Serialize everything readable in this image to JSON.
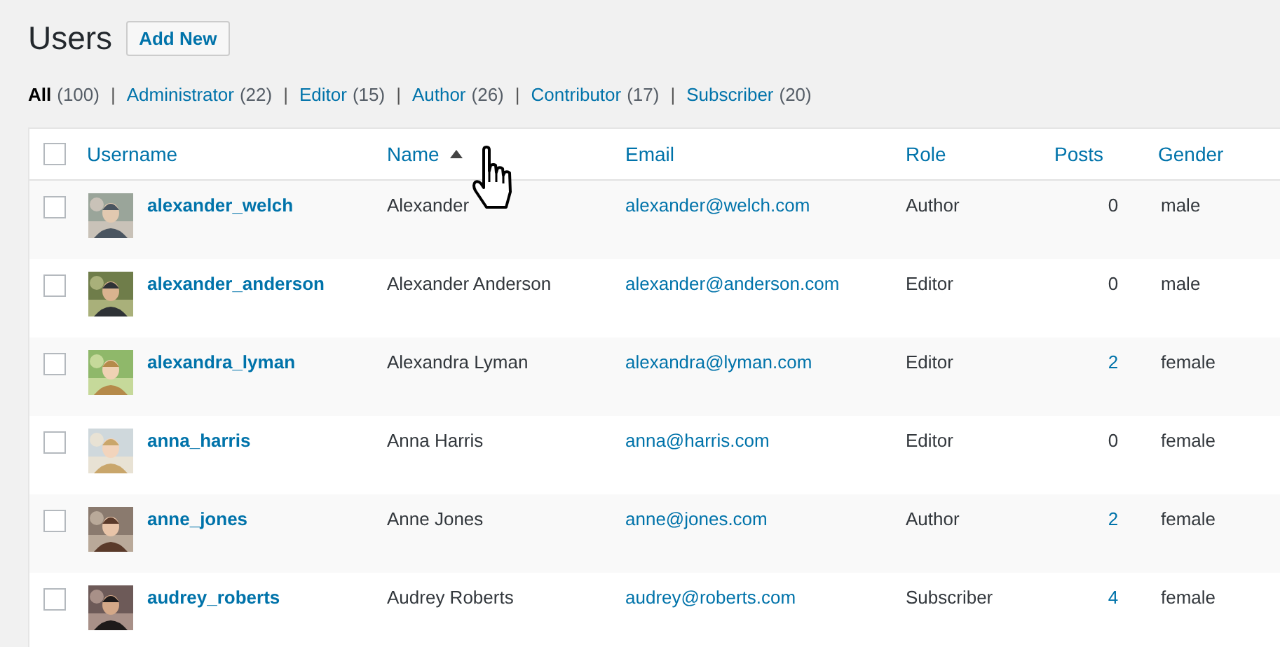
{
  "page_title": "Users",
  "add_button": "Add New",
  "filters": [
    {
      "label": "All",
      "count": "(100)",
      "selected": true
    },
    {
      "separator": "|",
      "label": "Administrator",
      "count": "(22)",
      "selected": false
    },
    {
      "separator": "|",
      "label": "Editor",
      "count": "(15)",
      "selected": false
    },
    {
      "separator": "|",
      "label": "Author",
      "count": "(26)",
      "selected": false
    },
    {
      "separator": "|",
      "label": "Contributor",
      "count": "(17)",
      "selected": false
    },
    {
      "separator": "|",
      "label": "Subscriber",
      "count": "(20)",
      "selected": false
    }
  ],
  "table": {
    "select_all_checked": false,
    "columns": [
      {
        "label": "Username",
        "sorted": false
      },
      {
        "label": "Name",
        "sorted": true
      },
      {
        "label": "Email",
        "sorted": false
      },
      {
        "label": "Role",
        "sorted": false
      },
      {
        "label": "Posts",
        "sorted": false
      },
      {
        "label": "Gender",
        "sorted": false
      }
    ],
    "rows": [
      {
        "checked": false,
        "username": "alexander_welch",
        "name": "Alexander",
        "email": "alexander@welch.com",
        "role": "Author",
        "posts": "0",
        "posts_linked": false,
        "gender": "male"
      },
      {
        "checked": false,
        "username": "alexander_anderson",
        "name": "Alexander Anderson",
        "email": "alexander@anderson.com",
        "role": "Editor",
        "posts": "0",
        "posts_linked": false,
        "gender": "male"
      },
      {
        "checked": false,
        "username": "alexandra_lyman",
        "name": "Alexandra Lyman",
        "email": "alexandra@lyman.com",
        "role": "Editor",
        "posts": "2",
        "posts_linked": true,
        "gender": "female"
      },
      {
        "checked": false,
        "username": "anna_harris",
        "name": "Anna Harris",
        "email": "anna@harris.com",
        "role": "Editor",
        "posts": "0",
        "posts_linked": false,
        "gender": "female"
      },
      {
        "checked": false,
        "username": "anne_jones",
        "name": "Anne Jones",
        "email": "anne@jones.com",
        "role": "Author",
        "posts": "2",
        "posts_linked": true,
        "gender": "female"
      },
      {
        "checked": false,
        "username": "audrey_roberts",
        "name": "Audrey Roberts",
        "email": "audrey@roberts.com",
        "role": "Subscriber",
        "posts": "4",
        "posts_linked": true,
        "gender": "female"
      }
    ]
  },
  "pointer_cursor": true
}
